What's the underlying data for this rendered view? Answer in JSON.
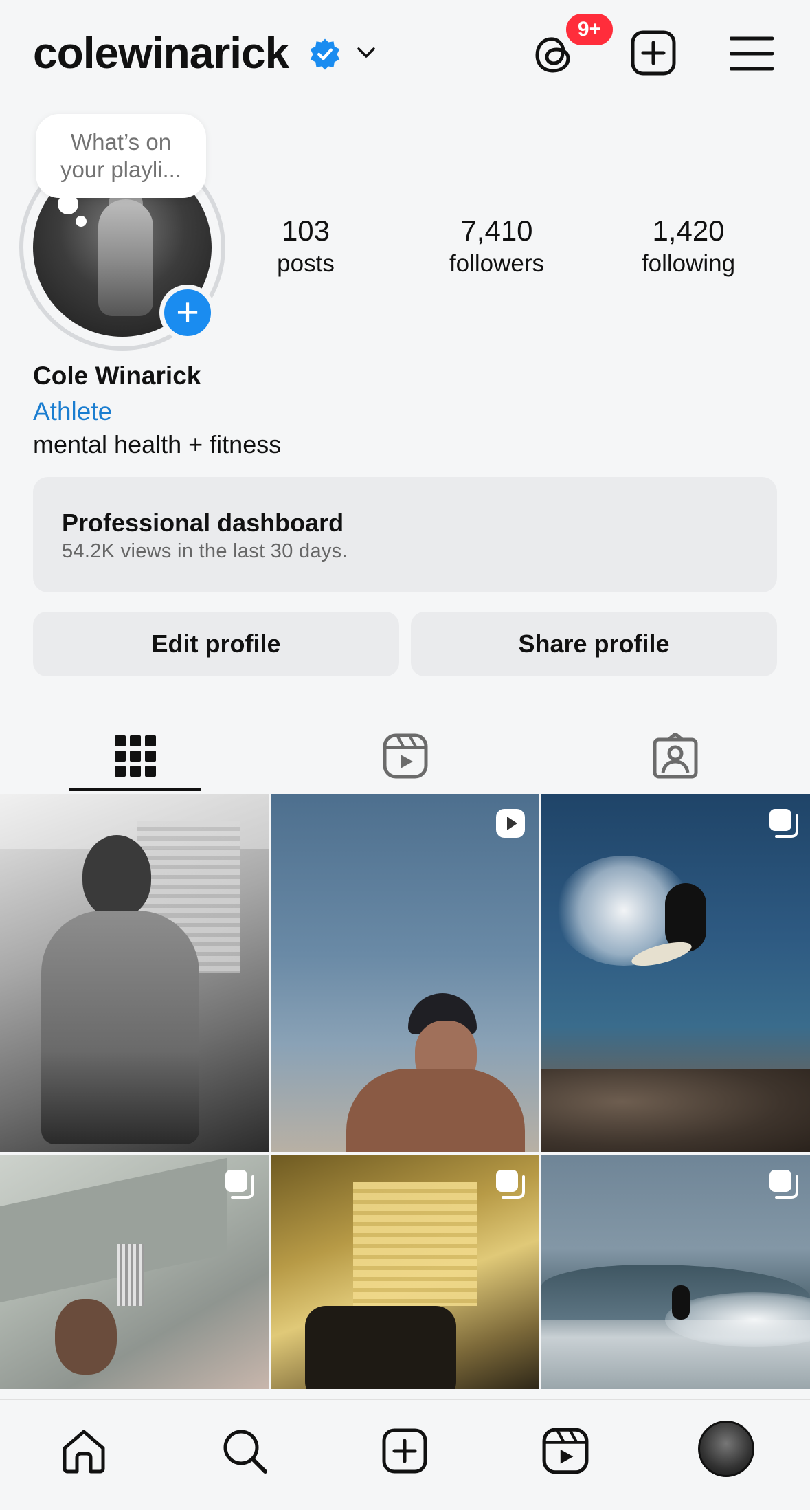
{
  "header": {
    "username": "colewinarick",
    "notification_count": "9+"
  },
  "profile": {
    "note_placeholder": "What’s on your playli...",
    "stats": {
      "posts": {
        "value": "103",
        "label": "posts"
      },
      "followers": {
        "value": "7,410",
        "label": "followers"
      },
      "following": {
        "value": "1,420",
        "label": "following"
      }
    },
    "full_name": "Cole Winarick",
    "category": "Athlete",
    "bio": "mental health + fitness"
  },
  "dashboard": {
    "title": "Professional dashboard",
    "views": "54.2K",
    "subtitle_rest": "views in the last 30 days."
  },
  "actions": {
    "edit_label": "Edit profile",
    "share_label": "Share profile"
  },
  "tabs": {
    "active": "grid",
    "items": [
      "grid-icon",
      "reels-icon",
      "tagged-icon"
    ]
  },
  "grid": {
    "posts": [
      {
        "type": "photo"
      },
      {
        "type": "reel",
        "badge_icon": "reel-play-icon"
      },
      {
        "type": "carousel",
        "badge_icon": "carousel-icon"
      },
      {
        "type": "carousel",
        "badge_icon": "carousel-icon"
      },
      {
        "type": "carousel",
        "badge_icon": "carousel-icon"
      },
      {
        "type": "carousel",
        "badge_icon": "carousel-icon"
      }
    ]
  },
  "bottom_nav": [
    "home-icon",
    "search-icon",
    "create-icon",
    "reels-icon",
    "profile-avatar"
  ],
  "colors": {
    "accent_blue": "#1a8cf0",
    "link_blue": "#1a7dd0",
    "badge_red": "#ff2d3b",
    "background": "#f5f6f7"
  }
}
